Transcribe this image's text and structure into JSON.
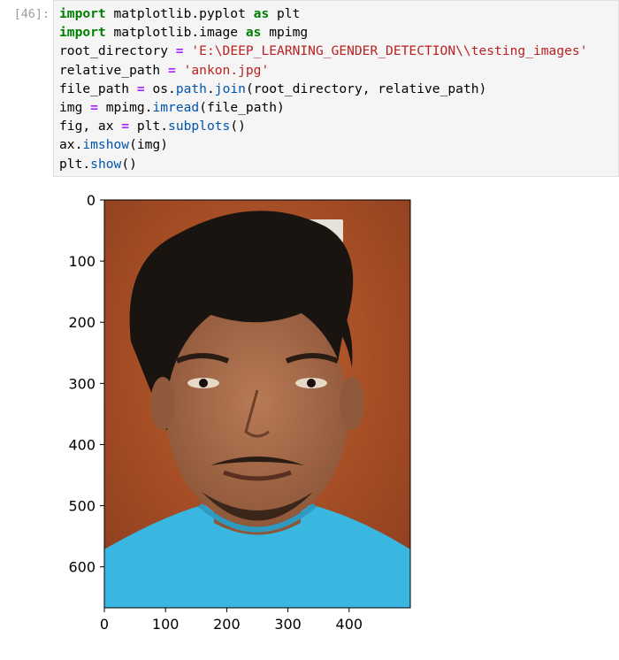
{
  "cell": {
    "prompt": "[46]:",
    "code_lines": [
      [
        {
          "t": "import",
          "c": "kw"
        },
        {
          "t": " matplotlib.pyplot ",
          "c": ""
        },
        {
          "t": "as",
          "c": "kw"
        },
        {
          "t": " plt",
          "c": ""
        }
      ],
      [
        {
          "t": "import",
          "c": "kw"
        },
        {
          "t": " matplotlib.image ",
          "c": ""
        },
        {
          "t": "as",
          "c": "kw"
        },
        {
          "t": " mpimg",
          "c": ""
        }
      ],
      [
        {
          "t": "root_directory ",
          "c": ""
        },
        {
          "t": "=",
          "c": "op"
        },
        {
          "t": " ",
          "c": ""
        },
        {
          "t": "'E:\\DEEP_LEARNING_GENDER_DETECTION\\\\testing_images'",
          "c": "str"
        }
      ],
      [
        {
          "t": "relative_path ",
          "c": ""
        },
        {
          "t": "=",
          "c": "op"
        },
        {
          "t": " ",
          "c": ""
        },
        {
          "t": "'ankon.jpg'",
          "c": "str"
        }
      ],
      [
        {
          "t": "file_path ",
          "c": ""
        },
        {
          "t": "=",
          "c": "op"
        },
        {
          "t": " os.",
          "c": ""
        },
        {
          "t": "path",
          "c": "attr"
        },
        {
          "t": ".",
          "c": ""
        },
        {
          "t": "join",
          "c": "attr"
        },
        {
          "t": "(root_directory, relative_path)",
          "c": ""
        }
      ],
      [
        {
          "t": "img ",
          "c": ""
        },
        {
          "t": "=",
          "c": "op"
        },
        {
          "t": " mpimg.",
          "c": ""
        },
        {
          "t": "imread",
          "c": "attr"
        },
        {
          "t": "(file_path)",
          "c": ""
        }
      ],
      [
        {
          "t": "fig, ax ",
          "c": ""
        },
        {
          "t": "=",
          "c": "op"
        },
        {
          "t": " plt.",
          "c": ""
        },
        {
          "t": "subplots",
          "c": "attr"
        },
        {
          "t": "()",
          "c": ""
        }
      ],
      [
        {
          "t": "ax.",
          "c": ""
        },
        {
          "t": "imshow",
          "c": "attr"
        },
        {
          "t": "(img)",
          "c": ""
        }
      ],
      [
        {
          "t": "plt.",
          "c": ""
        },
        {
          "t": "show",
          "c": "attr"
        },
        {
          "t": "()",
          "c": ""
        }
      ]
    ]
  },
  "figure": {
    "image_subject": "portrait-photo",
    "xticks": [
      "0",
      "100",
      "200",
      "300",
      "400"
    ],
    "yticks": [
      "0",
      "100",
      "200",
      "300",
      "400",
      "500",
      "600"
    ],
    "xlim": [
      0,
      500
    ],
    "ylim": [
      667,
      0
    ],
    "colors": {
      "wall": "#b5542a",
      "hair": "#1a1410",
      "skin": "#a66a4a",
      "shirt": "#3ab7e0"
    }
  }
}
